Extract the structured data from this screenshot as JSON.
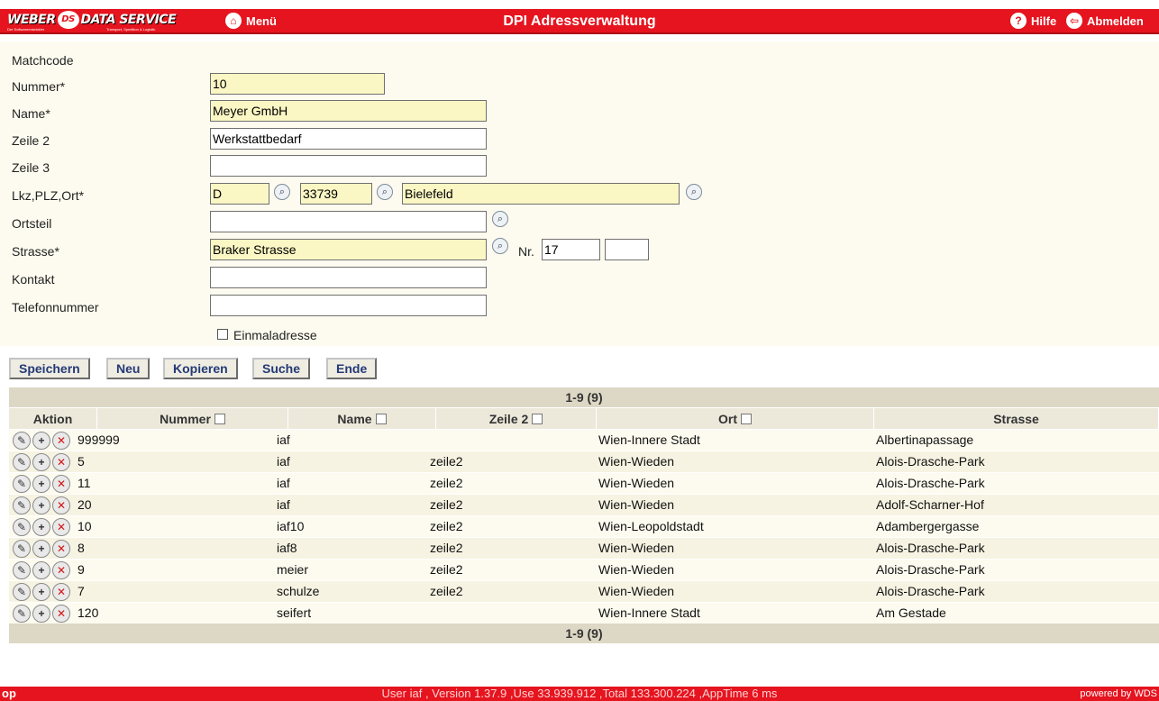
{
  "header": {
    "logo_text_1": "WEBER",
    "logo_badge": "DS",
    "logo_text_2": "DATA SERVICE",
    "logo_sub_1": "Der Softwareentwickler",
    "logo_sub_2": "Transport, Spedition & Logistik",
    "menu_label": "Menü",
    "title": "DPI Adressverwaltung",
    "help_label": "Hilfe",
    "logout_label": "Abmelden"
  },
  "form": {
    "matchcode_label": "Matchcode",
    "nummer_label": "Nummer*",
    "nummer_value": "10",
    "name_label": "Name*",
    "name_value": "Meyer GmbH",
    "zeile2_label": "Zeile 2",
    "zeile2_value": "Werkstattbedarf",
    "zeile3_label": "Zeile 3",
    "zeile3_value": "",
    "lkzplzort_label": "Lkz,PLZ,Ort*",
    "lkz_value": "D",
    "plz_value": "33739",
    "ort_value": "Bielefeld",
    "ortsteil_label": "Ortsteil",
    "ortsteil_value": "",
    "strasse_label": "Strasse*",
    "strasse_value": "Braker Strasse",
    "nr_label": "Nr.",
    "nr_value": "17",
    "nr_zusatz_value": "",
    "kontakt_label": "Kontakt",
    "kontakt_value": "",
    "telefon_label": "Telefonnummer",
    "telefon_value": "",
    "einmal_label": "Einmaladresse"
  },
  "buttons": {
    "save": "Speichern",
    "new": "Neu",
    "copy": "Kopieren",
    "search": "Suche",
    "end": "Ende"
  },
  "table": {
    "pager": "1-9 (9)",
    "columns": [
      "Aktion",
      "Nummer",
      "Name",
      "Zeile 2",
      "Ort",
      "Strasse"
    ],
    "rows": [
      {
        "nummer": "999999",
        "name": "iaf",
        "zeile2": "",
        "ort": "Wien-Innere Stadt",
        "strasse": "Albertinapassage"
      },
      {
        "nummer": "5",
        "name": "iaf",
        "zeile2": "zeile2",
        "ort": "Wien-Wieden",
        "strasse": "Alois-Drasche-Park"
      },
      {
        "nummer": "11",
        "name": "iaf",
        "zeile2": "zeile2",
        "ort": "Wien-Wieden",
        "strasse": "Alois-Drasche-Park"
      },
      {
        "nummer": "20",
        "name": "iaf",
        "zeile2": "zeile2",
        "ort": "Wien-Wieden",
        "strasse": "Adolf-Scharner-Hof"
      },
      {
        "nummer": "10",
        "name": "iaf10",
        "zeile2": "zeile2",
        "ort": "Wien-Leopoldstadt",
        "strasse": "Adambergergasse"
      },
      {
        "nummer": "8",
        "name": "iaf8",
        "zeile2": "zeile2",
        "ort": "Wien-Wieden",
        "strasse": "Alois-Drasche-Park"
      },
      {
        "nummer": "9",
        "name": "meier",
        "zeile2": "zeile2",
        "ort": "Wien-Wieden",
        "strasse": "Alois-Drasche-Park"
      },
      {
        "nummer": "7",
        "name": "schulze",
        "zeile2": "zeile2",
        "ort": "Wien-Wieden",
        "strasse": "Alois-Drasche-Park"
      },
      {
        "nummer": "120",
        "name": "seifert",
        "zeile2": "",
        "ort": "Wien-Innere Stadt",
        "strasse": "Am Gestade"
      }
    ]
  },
  "footer": {
    "top": "op",
    "status": "User iaf , Version 1.37.9 ,Use 33.939.912 ,Total 133.300.224 ,AppTime 6 ms",
    "powered": "powered by WDS"
  },
  "colors": {
    "brand_red": "#e5141e",
    "form_bg": "#fdfbef",
    "required_field": "#fbf7c4",
    "button_text": "#243a76"
  }
}
